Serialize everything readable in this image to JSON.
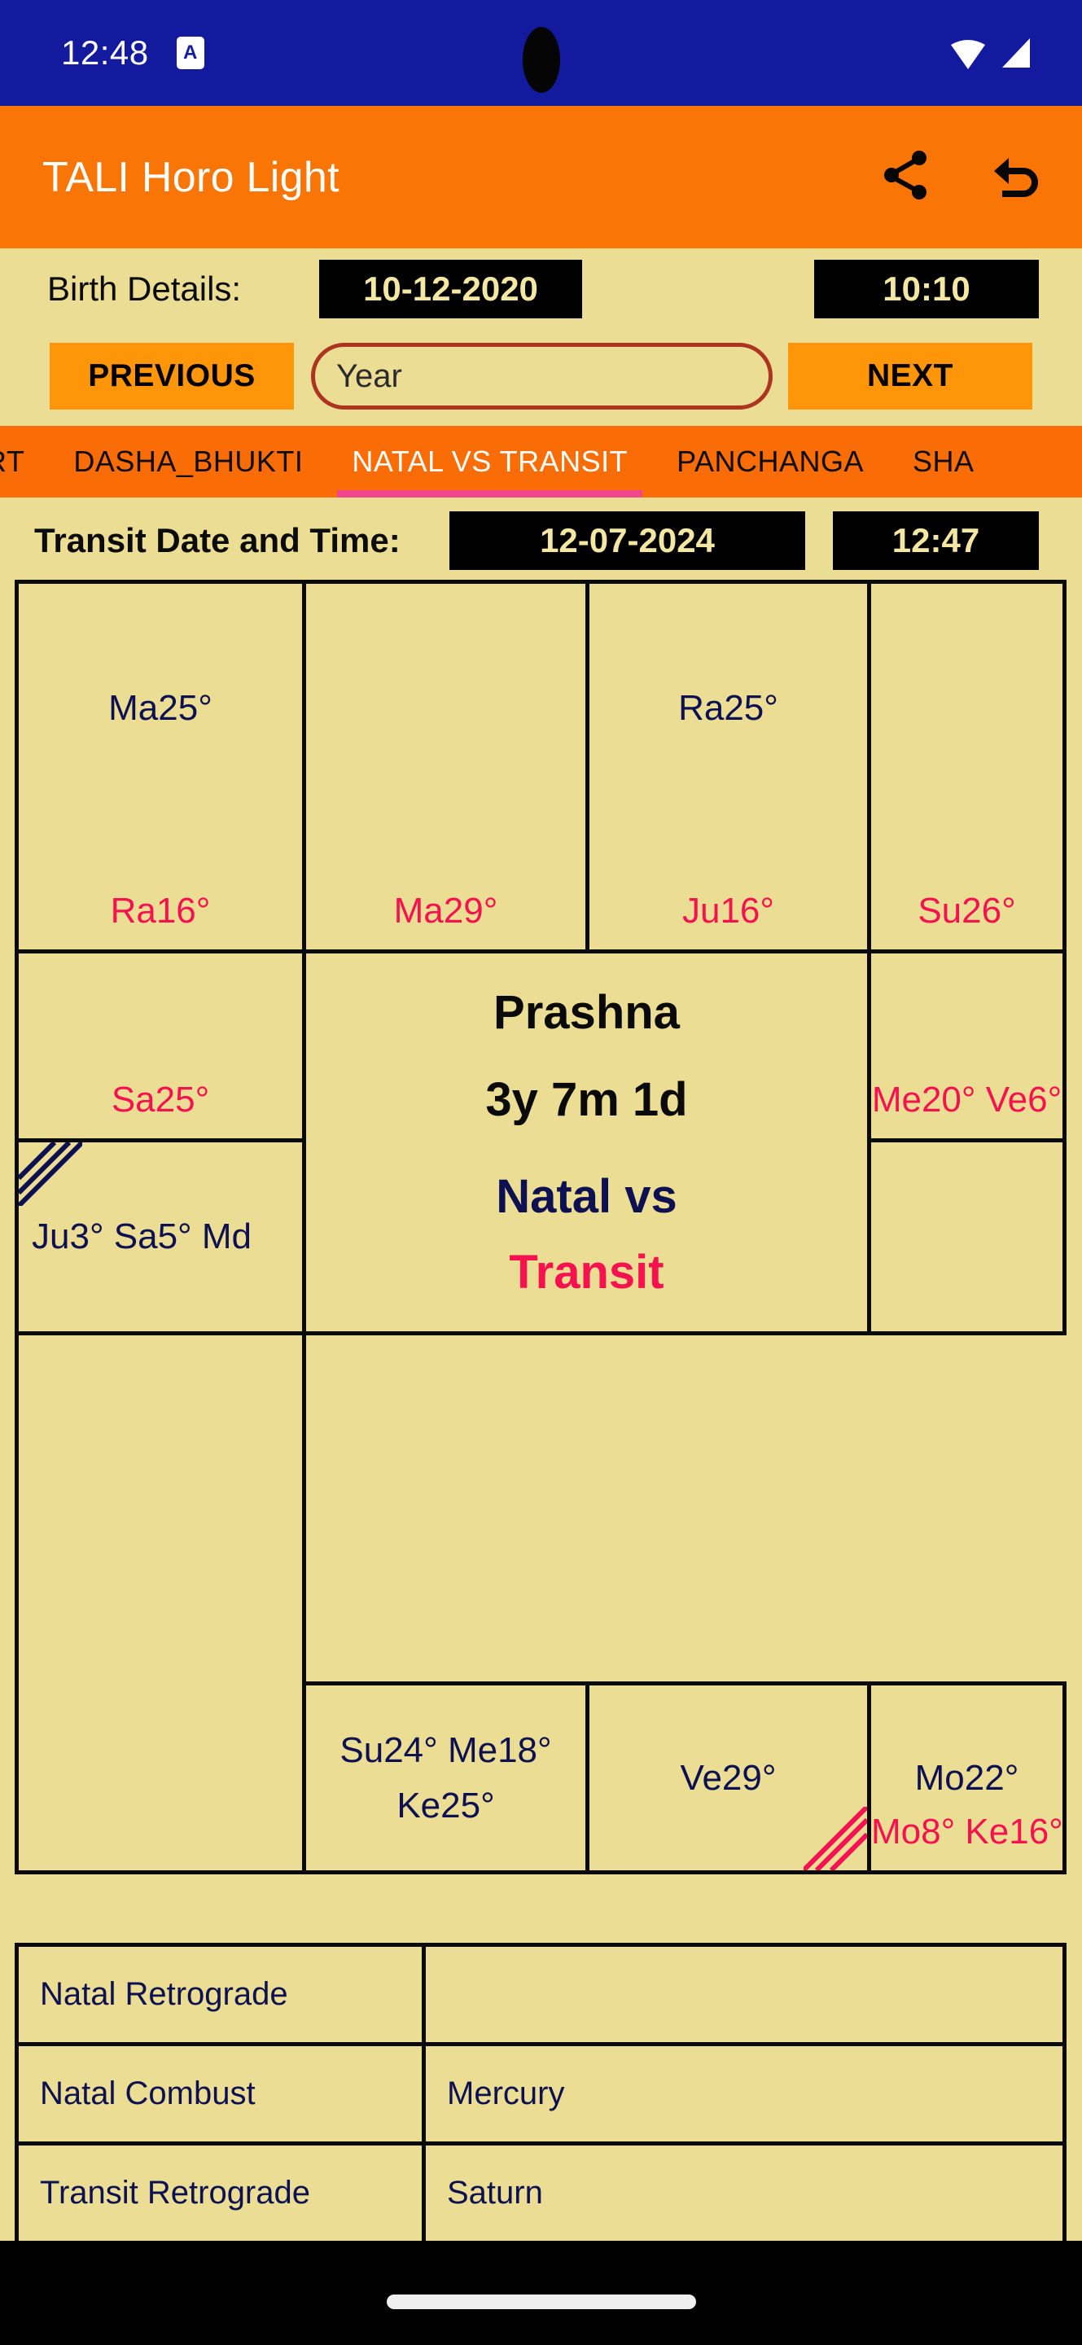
{
  "status_bar": {
    "time": "12:48",
    "badge_letter": "A",
    "icons": [
      "wifi-icon",
      "signal-icon"
    ],
    "background_color": "#131a9e"
  },
  "app_bar": {
    "title": "TALI Horo Light",
    "background_color": "#f97506",
    "actions": [
      {
        "name": "share-icon",
        "label": "Share"
      },
      {
        "name": "undo-icon",
        "label": "Undo"
      }
    ]
  },
  "birth_details": {
    "label": "Birth Details:",
    "date": "10-12-2020",
    "time": "10:10"
  },
  "navigation": {
    "previous_label": "PREVIOUS",
    "next_label": "NEXT",
    "year_placeholder": "Year",
    "year_value": ""
  },
  "tabs": [
    {
      "label": "RT",
      "active": false
    },
    {
      "label": "DASHA_BHUKTI",
      "active": false
    },
    {
      "label": "NATAL VS TRANSIT",
      "active": true
    },
    {
      "label": "PANCHANGA",
      "active": false
    },
    {
      "label": "SHA",
      "active": false
    }
  ],
  "transit": {
    "label": "Transit Date and Time:",
    "date": "12-07-2024",
    "time": "12:47"
  },
  "chart": {
    "centre": {
      "line1": "Prashna",
      "line2": "3y 7m 1d",
      "line3": "Natal vs",
      "line4": "Transit"
    },
    "cells": [
      {
        "id": "cell-1",
        "natal": "Ma25°",
        "transit": "Ra16°"
      },
      {
        "id": "cell-2",
        "natal": "",
        "transit": "Ma29°"
      },
      {
        "id": "cell-3",
        "natal": "Ra25°",
        "transit": "Ju16°"
      },
      {
        "id": "cell-4",
        "natal": "",
        "transit": "Su26°"
      },
      {
        "id": "cell-5",
        "natal": "",
        "transit": "Sa25°"
      },
      {
        "id": "cell-6",
        "natal": "",
        "transit": "Me20° Ve6°"
      },
      {
        "id": "cell-7",
        "natal": "Ju3° Sa5° Md",
        "transit": ""
      },
      {
        "id": "cell-8",
        "natal": "",
        "transit": ""
      },
      {
        "id": "cell-9",
        "natal": "",
        "transit": ""
      },
      {
        "id": "cell-10",
        "natal": "Su24° Me18°\nKe25°",
        "transit": ""
      },
      {
        "id": "cell-11",
        "natal": "Ve29°",
        "transit": ""
      },
      {
        "id": "cell-12",
        "natal": "Mo22°",
        "transit": "Mo8° Ke16°"
      }
    ],
    "natal_color": "#0d1152",
    "transit_color": "#f5124f",
    "cell_background": "#ecdd94"
  },
  "info_table": {
    "rows": [
      {
        "key": "Natal Retrograde",
        "value": ""
      },
      {
        "key": "Natal Combust",
        "value": "Mercury"
      },
      {
        "key": "Transit Retrograde",
        "value": "Saturn"
      }
    ]
  }
}
